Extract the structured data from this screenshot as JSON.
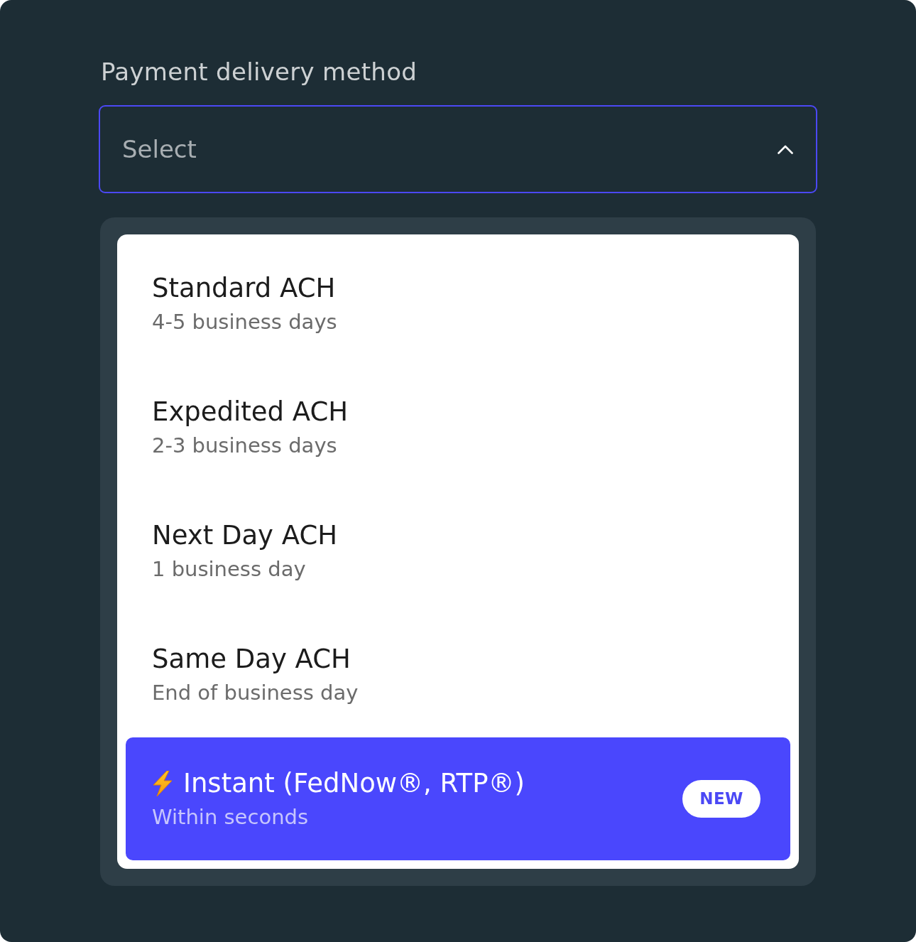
{
  "field": {
    "label": "Payment delivery method",
    "placeholder": "Select",
    "expanded": true
  },
  "options": [
    {
      "kind": "plain",
      "title": "Standard ACH",
      "subtitle": "4-5 business days",
      "selected": false
    },
    {
      "kind": "plain",
      "title": "Expedited ACH",
      "subtitle": "2-3 business days",
      "selected": false
    },
    {
      "kind": "plain",
      "title": "Next Day ACH",
      "subtitle": "1 business day",
      "selected": false
    },
    {
      "kind": "plain",
      "title": "Same Day ACH",
      "subtitle": "End of business day",
      "selected": false
    },
    {
      "kind": "instant",
      "title": "Instant (FedNow®, RTP®)",
      "subtitle": "Within seconds",
      "selected": true,
      "badge": "NEW"
    }
  ]
}
